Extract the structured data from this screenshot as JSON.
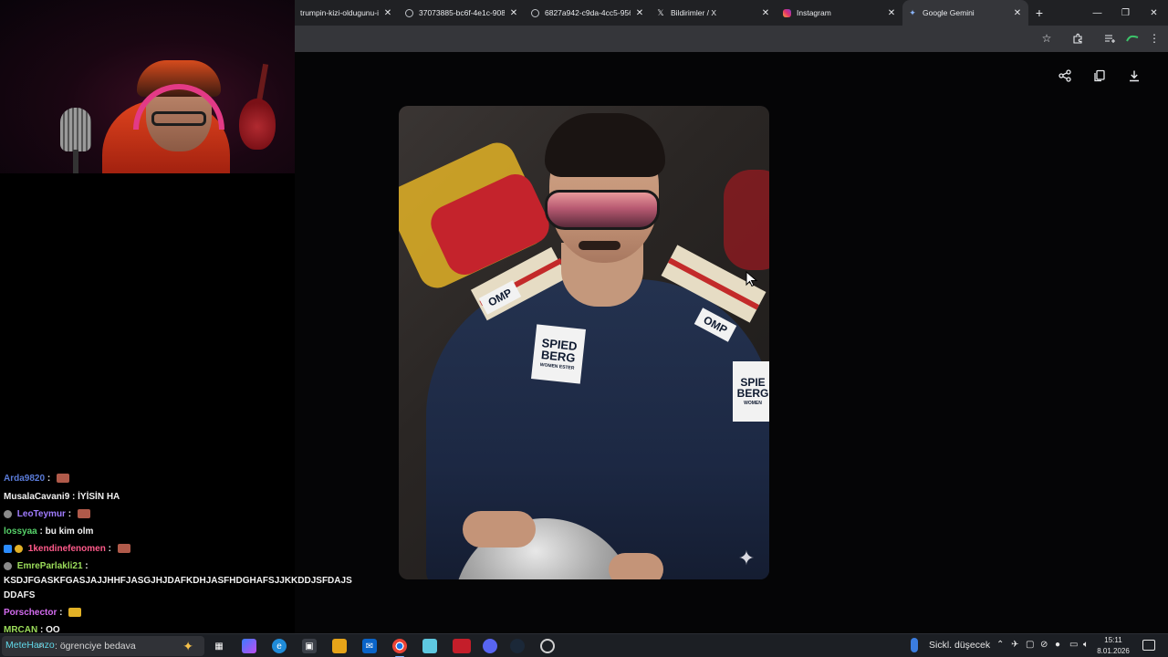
{
  "browser": {
    "tabs": [
      {
        "title": "trumpin-kizi-oldugunu-id",
        "icon": "globe-icon",
        "active": false
      },
      {
        "title": "37073885-bc6f-4e1c-908",
        "icon": "globe-icon",
        "active": false
      },
      {
        "title": "6827a942-c9da-4cc5-956",
        "icon": "globe-icon",
        "active": false
      },
      {
        "title": "Bildirimler / X",
        "icon": "x-logo-icon",
        "active": false
      },
      {
        "title": "Instagram",
        "icon": "instagram-icon",
        "active": false
      },
      {
        "title": "Google Gemini",
        "icon": "gemini-icon",
        "active": true
      }
    ],
    "new_tab_label": "+",
    "close_glyph": "✕"
  },
  "viewer": {
    "actions": [
      "share-icon",
      "copy-icon",
      "download-icon"
    ],
    "photo_patches": {
      "omp_left": "OMP",
      "omp_right": "OMP",
      "spied_top": "SPIED",
      "spied_bottom": "BERG",
      "spied_small": "WOMEN ESTER",
      "spied_right_top": "SPIE",
      "spied_right_bottom": "BERG",
      "spied_right_small": "WOMEN"
    }
  },
  "chat": {
    "messages": [
      {
        "user": "MusalaCavani9",
        "text": ": İYİSİN HA"
      },
      {
        "user": "LeoTeymur",
        "text": ":"
      },
      {
        "user": "lossyaa",
        "text": ": bu kim olm"
      },
      {
        "user": "1kendinefenomen",
        "text": ":"
      },
      {
        "user": "EmreParlakli21",
        "text": ":"
      },
      {
        "long_text": "KSDJFGASKFGASJAJJHHFJASGJHJDAFKDHJASFHDGHAFSJJKKDDJSFDAJS DDAFS"
      },
      {
        "user": "Porschector",
        "text": ":"
      },
      {
        "user": "MRCAN",
        "text": ": OO"
      },
      {
        "user": "MeteHanzo",
        "text": ": ögrenciye bedava"
      }
    ],
    "truncated_top_user": "Arda9820"
  },
  "taskbar": {
    "search_text": "ögrenciye bedava",
    "weather": "Sickl. düşecek",
    "time": "15:11",
    "date": "8.01.2026"
  }
}
